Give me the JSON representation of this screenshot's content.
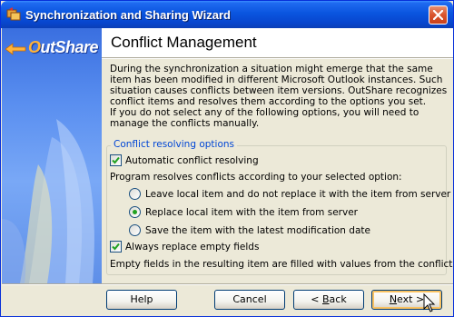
{
  "window": {
    "title": "Synchronization and Sharing Wizard",
    "title_color": "#0A55DF"
  },
  "sidebar": {
    "logo_first": "O",
    "logo_rest": "utShare"
  },
  "header": {
    "title": "Conflict Management"
  },
  "description": {
    "paragraph1": "During the synchronization a situation might emerge that the same item has been modified in different Microsoft Outlook instances. Such situation causes conflicts between item versions. OutShare recognizes conflict items and resolves them according to the options you set.",
    "paragraph2": "If you do not select any of the following options, you will need to manage the conflicts manually."
  },
  "options": {
    "group_label": "Conflict resolving options",
    "auto_resolve": {
      "label": "Automatic conflict resolving",
      "checked": true
    },
    "resolve_intro": "Program resolves conflicts according to your selected option:",
    "radios": [
      {
        "label": "Leave local item and do not replace it with the item from server",
        "selected": false
      },
      {
        "label": "Replace local item with the item from server",
        "selected": true
      },
      {
        "label": "Save the item with the latest modification date",
        "selected": false
      }
    ],
    "replace_empty": {
      "label": "Always replace empty fields",
      "checked": true
    },
    "empty_note": "Empty fields in the resulting item are filled with values from the conflict"
  },
  "buttons": {
    "help": "Help",
    "cancel": "Cancel",
    "back_prefix": "< ",
    "back_key": "B",
    "back_rest": "ack",
    "next_key": "N",
    "next_rest": "ext >"
  },
  "icons": {
    "title": "wizard-app-icon",
    "close": "close-icon",
    "logo": "outshare-logo-icon",
    "cursor": "mouse-pointer-icon"
  }
}
